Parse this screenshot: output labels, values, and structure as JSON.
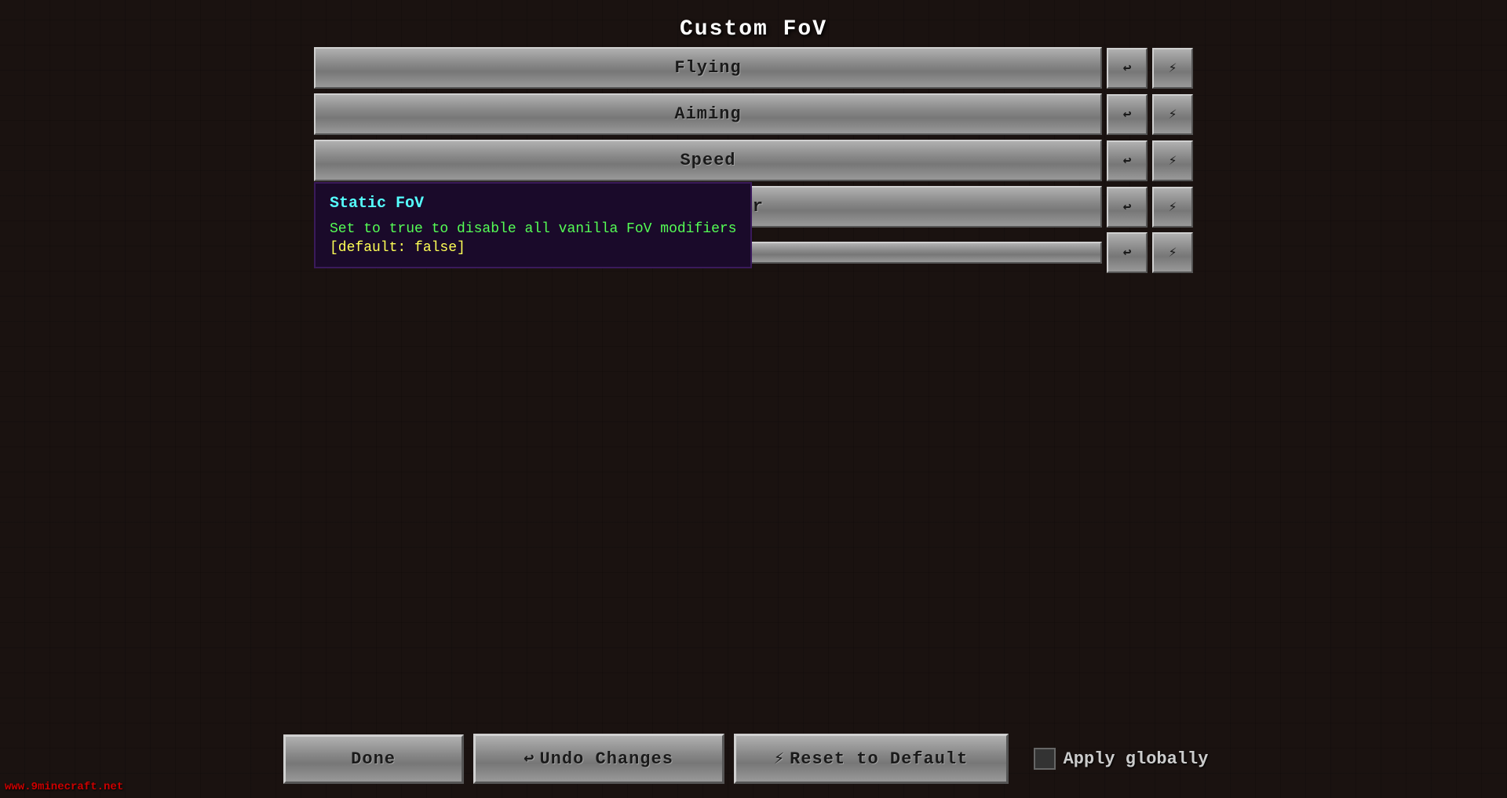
{
  "page": {
    "title": "Custom FoV",
    "watermark": "www.9minecraft.net"
  },
  "settings": {
    "items": [
      {
        "id": "flying",
        "label": "Flying"
      },
      {
        "id": "aiming",
        "label": "Aiming"
      },
      {
        "id": "speed",
        "label": "Speed"
      },
      {
        "id": "underwater",
        "label": "Underwater"
      },
      {
        "id": "static-fov",
        "label": "Static FoV",
        "show_label": true,
        "label_prefix": "Static F"
      }
    ],
    "undo_icon": "↩",
    "reset_icon": "⚡"
  },
  "tooltip": {
    "title": "Static FoV",
    "description": "Set to true to disable all vanilla FoV modifiers",
    "default_text": "[default: false]"
  },
  "bottom_bar": {
    "done_label": "Done",
    "undo_label": "Undo Changes",
    "reset_label": "Reset to Default",
    "apply_globally_label": "Apply globally",
    "undo_icon": "↩",
    "reset_icon": "⚡"
  }
}
